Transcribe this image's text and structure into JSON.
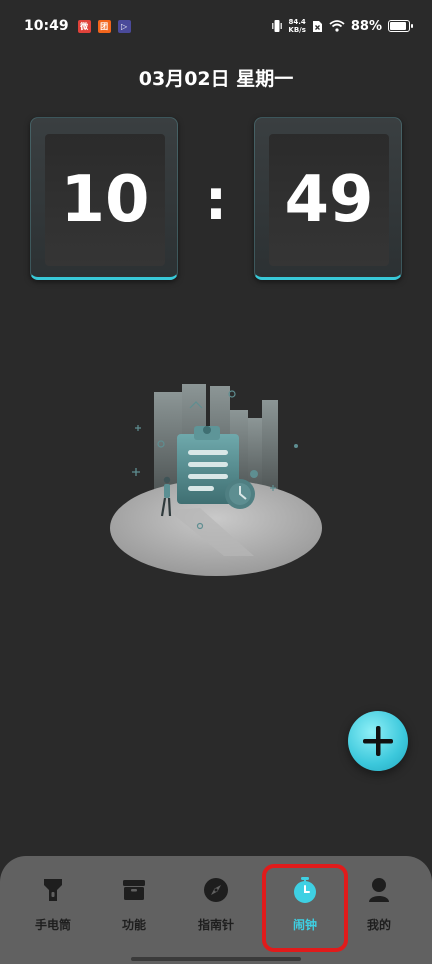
{
  "status_bar": {
    "time": "10:49",
    "app_badges": [
      {
        "label": "微",
        "color": "#e0423a"
      },
      {
        "label": "团",
        "color": "#f2651c"
      },
      {
        "label": "▷",
        "color": "#4a4a9a"
      }
    ],
    "net_speed_value": "84.4",
    "net_speed_unit": "KB/s",
    "battery_percent": "88%",
    "battery_level": 0.88
  },
  "date": "03月02日 星期一",
  "clock": {
    "hours": "10",
    "separator": ":",
    "minutes": "49"
  },
  "fab": {
    "icon": "plus-icon"
  },
  "bottom_nav": {
    "items": [
      {
        "label": "手电筒",
        "icon": "flashlight-icon",
        "active": false
      },
      {
        "label": "功能",
        "icon": "toolbox-icon",
        "active": false
      },
      {
        "label": "指南针",
        "icon": "compass-icon",
        "active": false
      },
      {
        "label": "闹钟",
        "icon": "alarm-clock-icon",
        "active": true
      },
      {
        "label": "我的",
        "icon": "user-icon",
        "active": false
      }
    ]
  },
  "colors": {
    "accent": "#3ed0e3",
    "background": "#2a2a2a",
    "nav_background": "#616161",
    "highlight": "#e01b1b"
  }
}
